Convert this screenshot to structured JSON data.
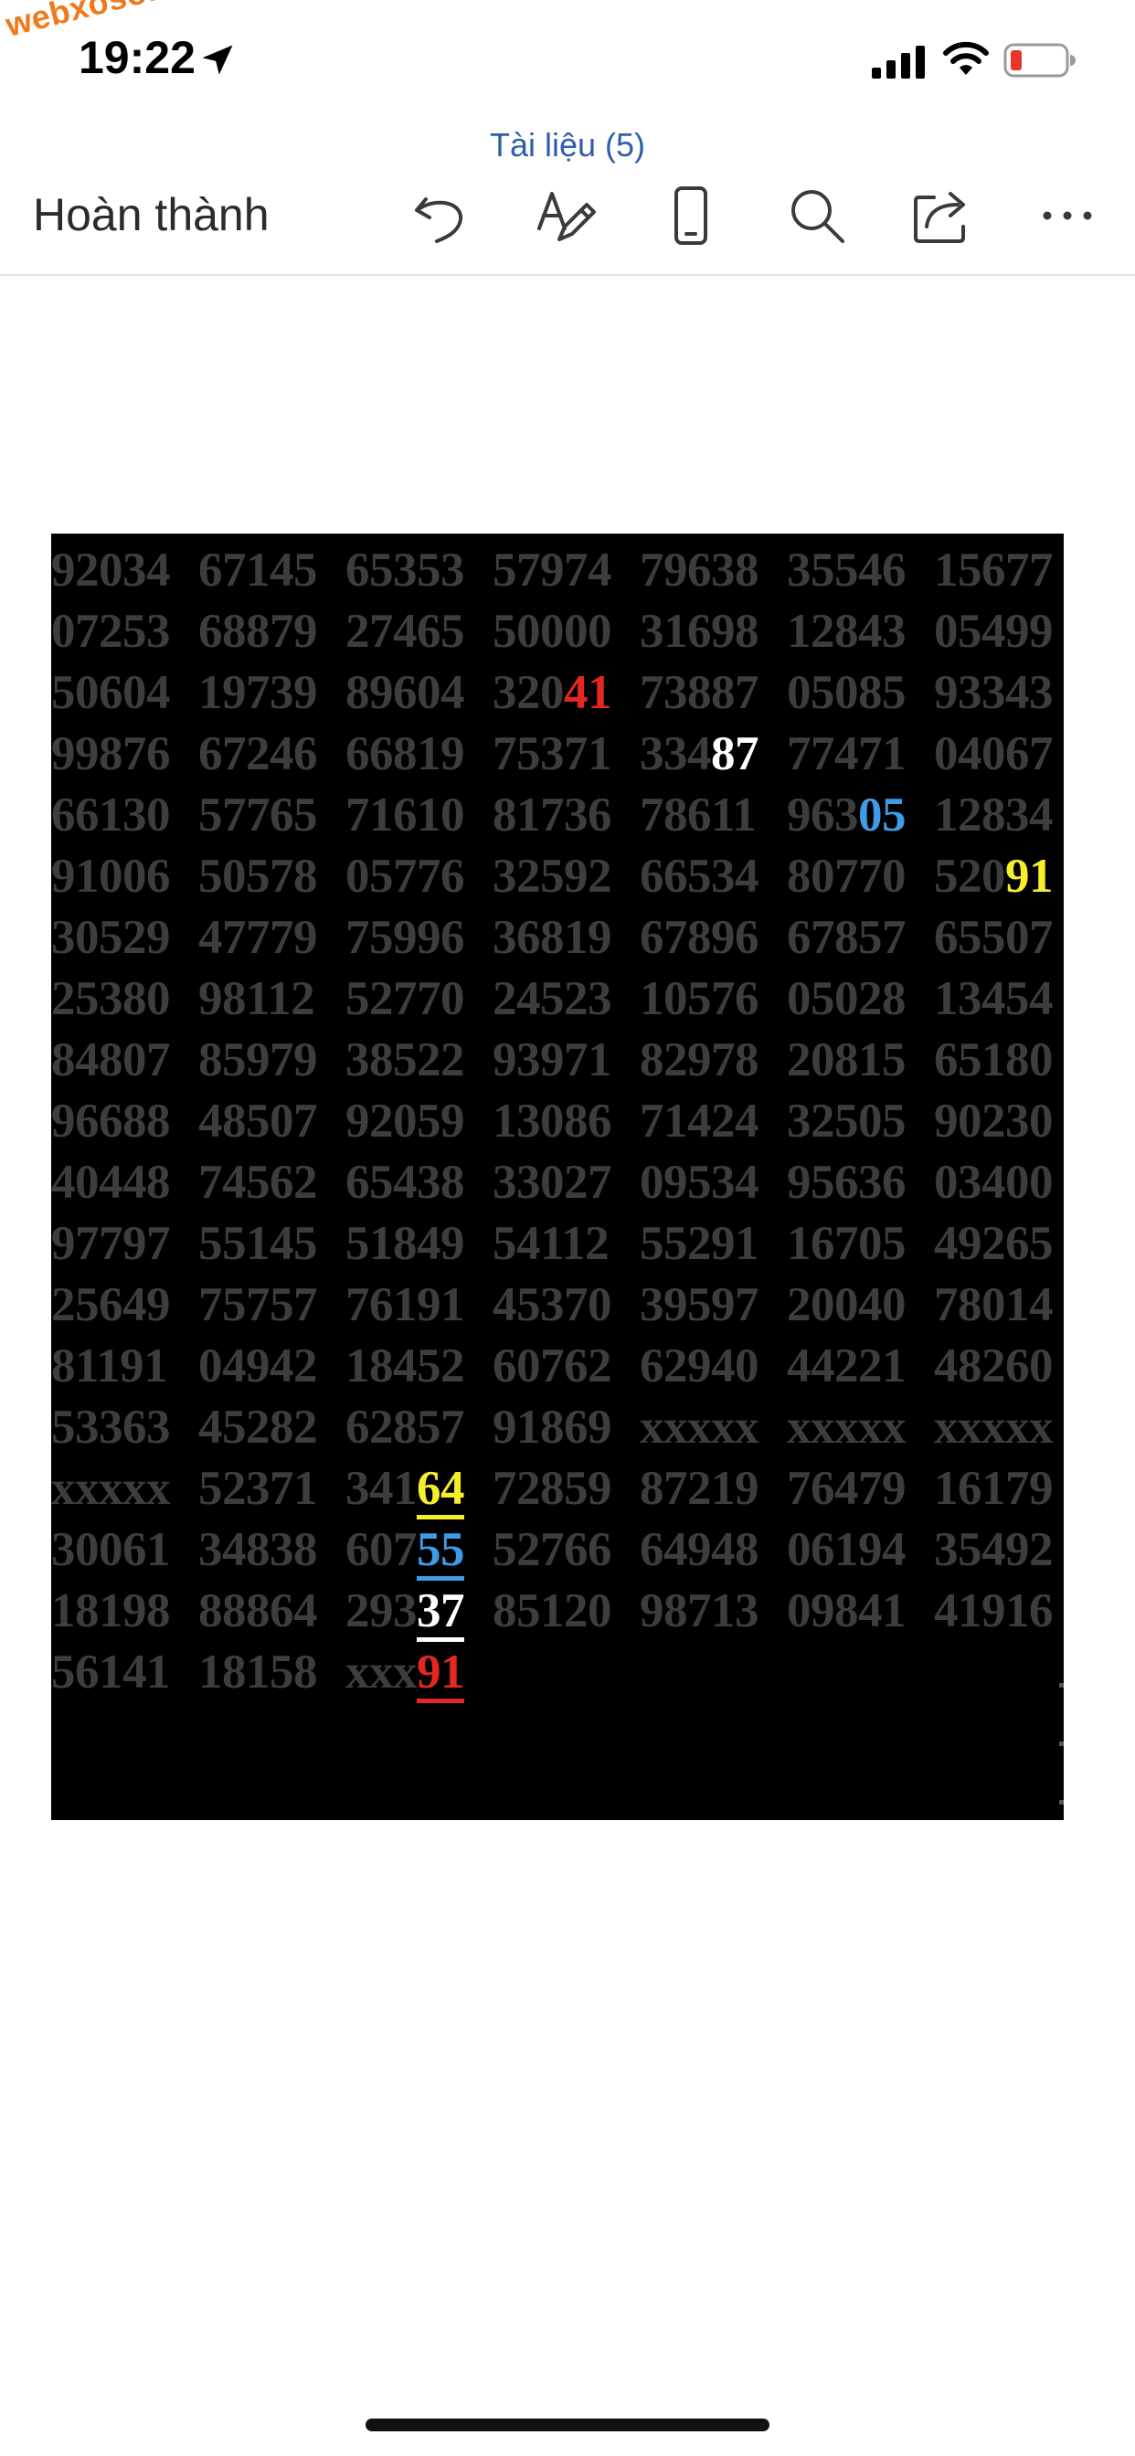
{
  "status_bar": {
    "watermark": "webxoso.net",
    "time": "19:22"
  },
  "nav": {
    "document_title": "Tài liệu (5)",
    "done_label": "Hoàn thành",
    "toolbar_icons": [
      "undo-icon",
      "draw-icon",
      "mobile-view-icon",
      "search-icon",
      "share-icon",
      "more-icon"
    ]
  },
  "number_table": {
    "rows": [
      [
        [
          "92034"
        ],
        [
          "67145"
        ],
        [
          "65353"
        ],
        [
          "57974"
        ],
        [
          "79638"
        ],
        [
          "35546"
        ],
        [
          "15677"
        ]
      ],
      [
        [
          "07253"
        ],
        [
          "68879"
        ],
        [
          "27465"
        ],
        [
          "50000"
        ],
        [
          "31698"
        ],
        [
          "12843"
        ],
        [
          "05499"
        ]
      ],
      [
        [
          "50604"
        ],
        [
          "19739"
        ],
        [
          "89604"
        ],
        [
          "320",
          {
            "t": "41",
            "c": "red"
          }
        ],
        [
          "73887"
        ],
        [
          "05085"
        ],
        [
          "93343"
        ]
      ],
      [
        [
          "99876"
        ],
        [
          "67246"
        ],
        [
          "66819"
        ],
        [
          "75371"
        ],
        [
          "334",
          {
            "t": "87",
            "c": "white"
          }
        ],
        [
          "77471"
        ],
        [
          "04067"
        ]
      ],
      [
        [
          "66130"
        ],
        [
          "57765"
        ],
        [
          "71610"
        ],
        [
          "81736"
        ],
        [
          "78611"
        ],
        [
          "963",
          {
            "t": "05",
            "c": "blue"
          }
        ],
        [
          "12834"
        ]
      ],
      [
        [
          "91006"
        ],
        [
          "50578"
        ],
        [
          "05776"
        ],
        [
          "32592"
        ],
        [
          "66534"
        ],
        [
          "80770"
        ],
        [
          "520",
          {
            "t": "91",
            "c": "yellow"
          }
        ]
      ],
      [
        [
          "30529"
        ],
        [
          "47779"
        ],
        [
          "75996"
        ],
        [
          "36819"
        ],
        [
          "67896"
        ],
        [
          "67857"
        ],
        [
          "65507"
        ]
      ],
      [
        [
          "25380"
        ],
        [
          "98112"
        ],
        [
          "52770"
        ],
        [
          "24523"
        ],
        [
          "10576"
        ],
        [
          "05028"
        ],
        [
          "13454"
        ]
      ],
      [
        [
          "84807"
        ],
        [
          "85979"
        ],
        [
          "38522"
        ],
        [
          "93971"
        ],
        [
          "82978"
        ],
        [
          "20815"
        ],
        [
          "65180"
        ]
      ],
      [
        [
          "96688"
        ],
        [
          "48507"
        ],
        [
          "92059"
        ],
        [
          "13086"
        ],
        [
          "71424"
        ],
        [
          "32505"
        ],
        [
          "90230"
        ]
      ],
      [
        [
          "40448"
        ],
        [
          "74562"
        ],
        [
          "65438"
        ],
        [
          "33027"
        ],
        [
          "09534"
        ],
        [
          "95636"
        ],
        [
          "03400"
        ]
      ],
      [
        [
          "97797"
        ],
        [
          "55145"
        ],
        [
          "51849"
        ],
        [
          "54112"
        ],
        [
          "55291"
        ],
        [
          "16705"
        ],
        [
          "49265"
        ]
      ],
      [
        [
          "25649"
        ],
        [
          "75757"
        ],
        [
          "76191"
        ],
        [
          "45370"
        ],
        [
          "39597"
        ],
        [
          "20040"
        ],
        [
          "78014"
        ]
      ],
      [
        [
          "81191"
        ],
        [
          "04942"
        ],
        [
          "18452"
        ],
        [
          "60762"
        ],
        [
          "62940"
        ],
        [
          "44221"
        ],
        [
          "48260"
        ]
      ],
      [
        [
          "53363"
        ],
        [
          "45282"
        ],
        [
          "62857"
        ],
        [
          "91869"
        ],
        [
          "xxxxx"
        ],
        [
          "xxxxx"
        ],
        [
          "xxxxx"
        ]
      ],
      [
        [
          "xxxxx"
        ],
        [
          "52371"
        ],
        [
          "341",
          {
            "t": "64",
            "c": "yellow",
            "u": true
          }
        ],
        [
          "72859"
        ],
        [
          "87219"
        ],
        [
          "76479"
        ],
        [
          "16179"
        ]
      ],
      [
        [
          "30061"
        ],
        [
          "34838"
        ],
        [
          "607",
          {
            "t": "55",
            "c": "blue",
            "u": true
          }
        ],
        [
          "52766"
        ],
        [
          "64948"
        ],
        [
          "06194"
        ],
        [
          "35492"
        ]
      ],
      [
        [
          "18198"
        ],
        [
          "88864"
        ],
        [
          "293",
          {
            "t": "37",
            "c": "white",
            "u": true
          }
        ],
        [
          "85120"
        ],
        [
          "98713"
        ],
        [
          "09841"
        ],
        [
          "41916"
        ]
      ],
      [
        [
          "56141"
        ],
        [
          "18158"
        ],
        [
          "xxx",
          {
            "t": "91",
            "c": "red",
            "u": true
          }
        ]
      ]
    ]
  }
}
